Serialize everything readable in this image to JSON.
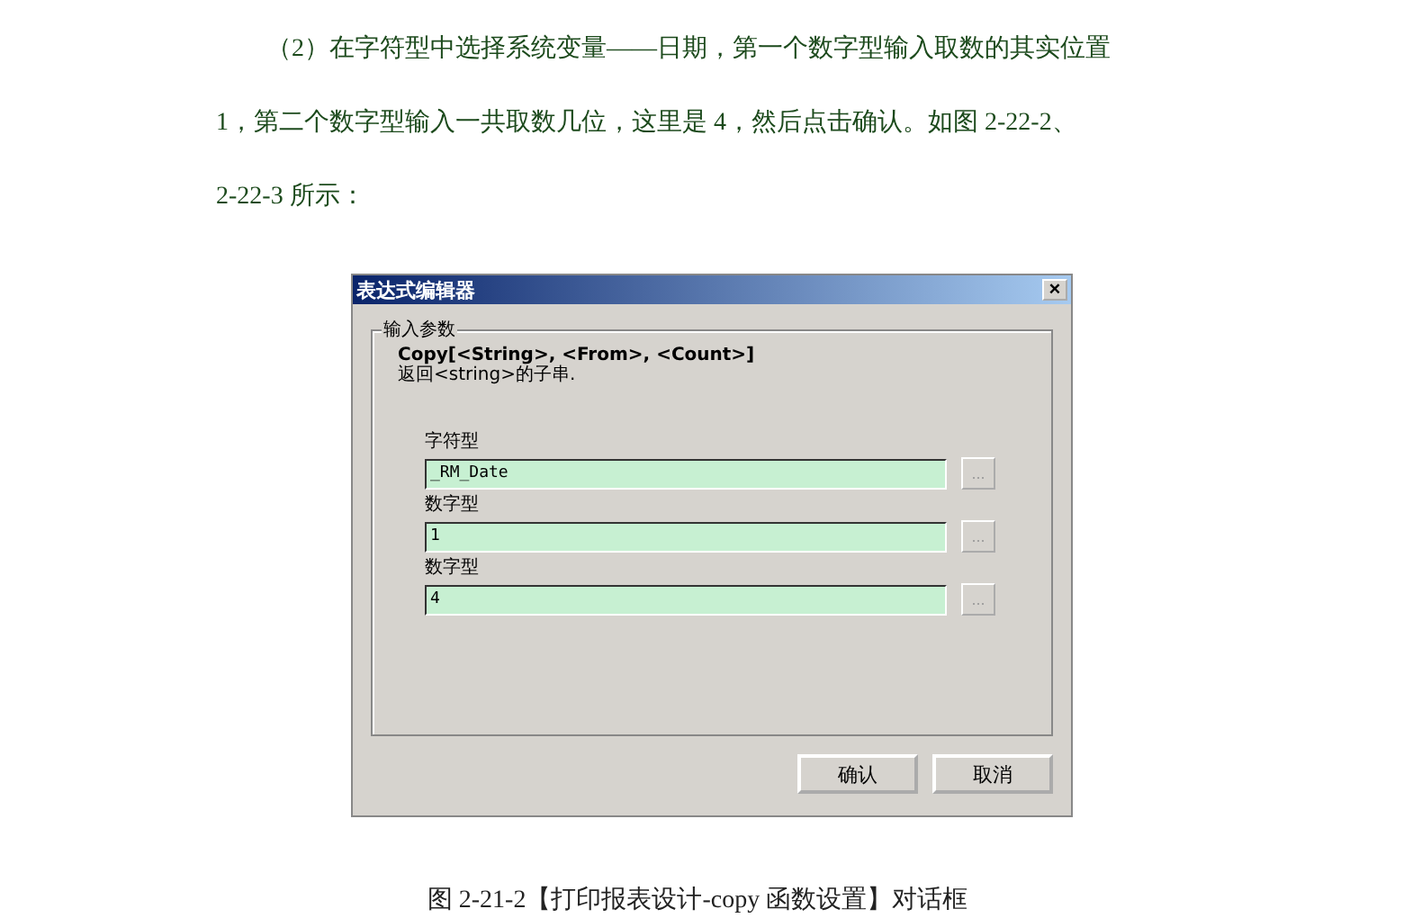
{
  "paragraph": {
    "lines": [
      "（2）在字符型中选择系统变量——日期，第一个数字型输入取数的其实位置",
      "1，第二个数字型输入一共取数几位，这里是 4，然后点击确认。如图 2-22-2、",
      "2-22-3 所示："
    ]
  },
  "dialog": {
    "title": "表达式编辑器",
    "close": "×",
    "group": {
      "legend": "输入参数",
      "signature": "Copy[<String>, <From>, <Count>]",
      "description": "返回<string>的子串.",
      "fields": [
        {
          "label": "字符型",
          "value": "_RM_Date",
          "browse": "..."
        },
        {
          "label": "数字型",
          "value": "1",
          "browse": "..."
        },
        {
          "label": "数字型",
          "value": "4",
          "browse": "..."
        }
      ]
    },
    "buttons": [
      "确认",
      "取消"
    ]
  },
  "caption": "图 2-21-2【打印报表设计-copy 函数设置】对话框"
}
